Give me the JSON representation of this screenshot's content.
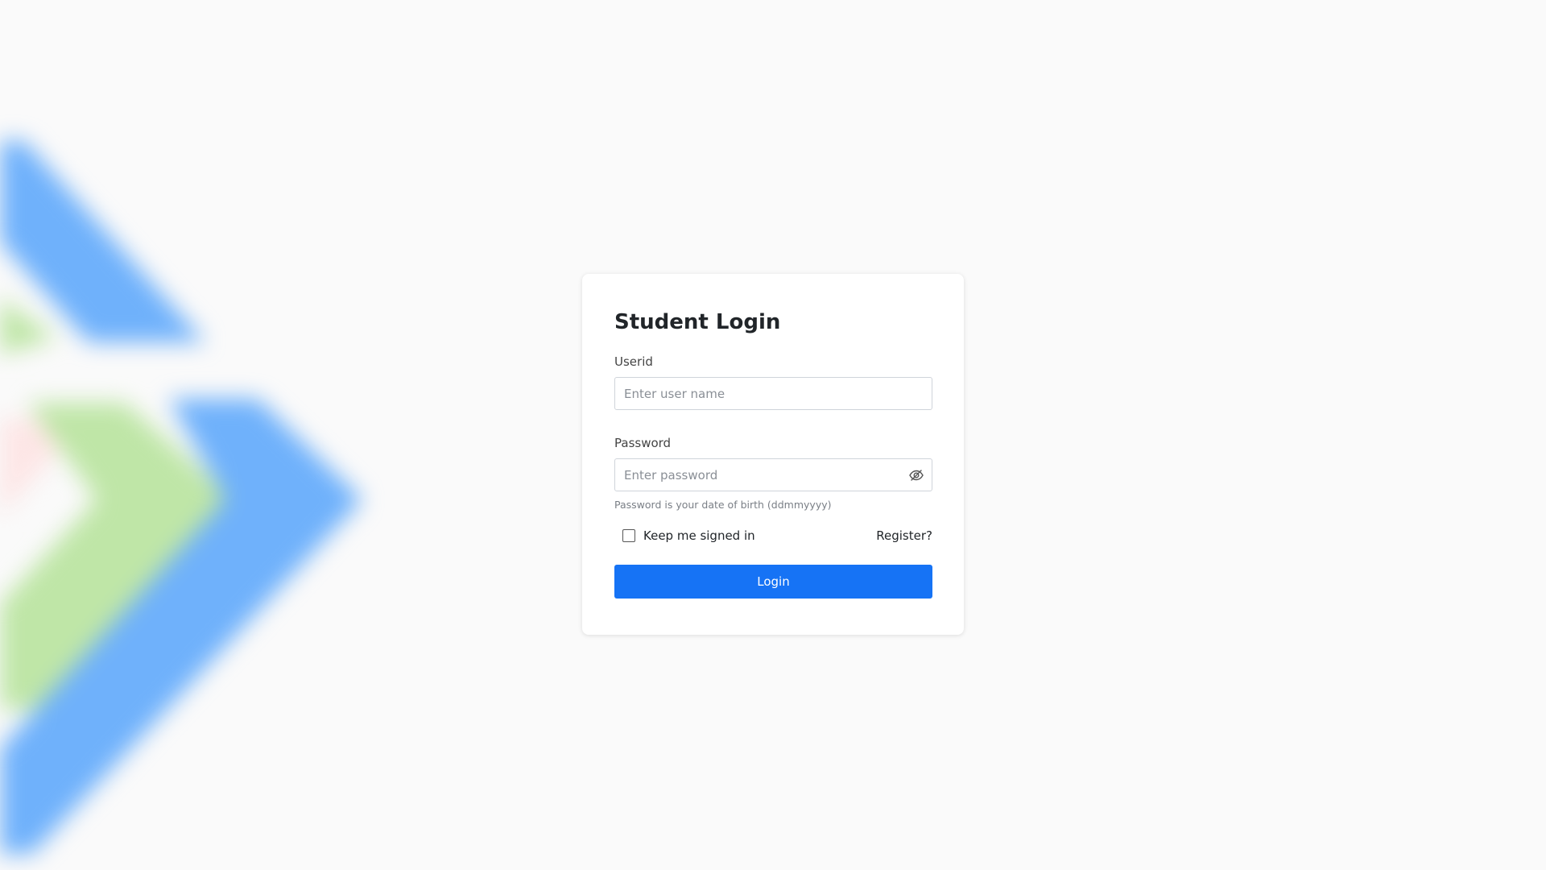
{
  "colors": {
    "accent": "#1673f5",
    "background": "#fafafa",
    "bg_art_blue": "#6fb1fb",
    "bg_art_green": "#bfe6a7",
    "bg_art_pink": "#fde6e6"
  },
  "login_card": {
    "title": "Student Login",
    "userid": {
      "label": "Userid",
      "placeholder": "Enter user name",
      "value": ""
    },
    "password": {
      "label": "Password",
      "placeholder": "Enter password",
      "value": "",
      "toggle_icon": "eye-slash-icon",
      "hint": "Password is your date of birth (ddmmyyyy)"
    },
    "remember_me": {
      "label": "Keep me signed in",
      "checked": false
    },
    "register_link": "Register?",
    "login_button": "Login"
  }
}
